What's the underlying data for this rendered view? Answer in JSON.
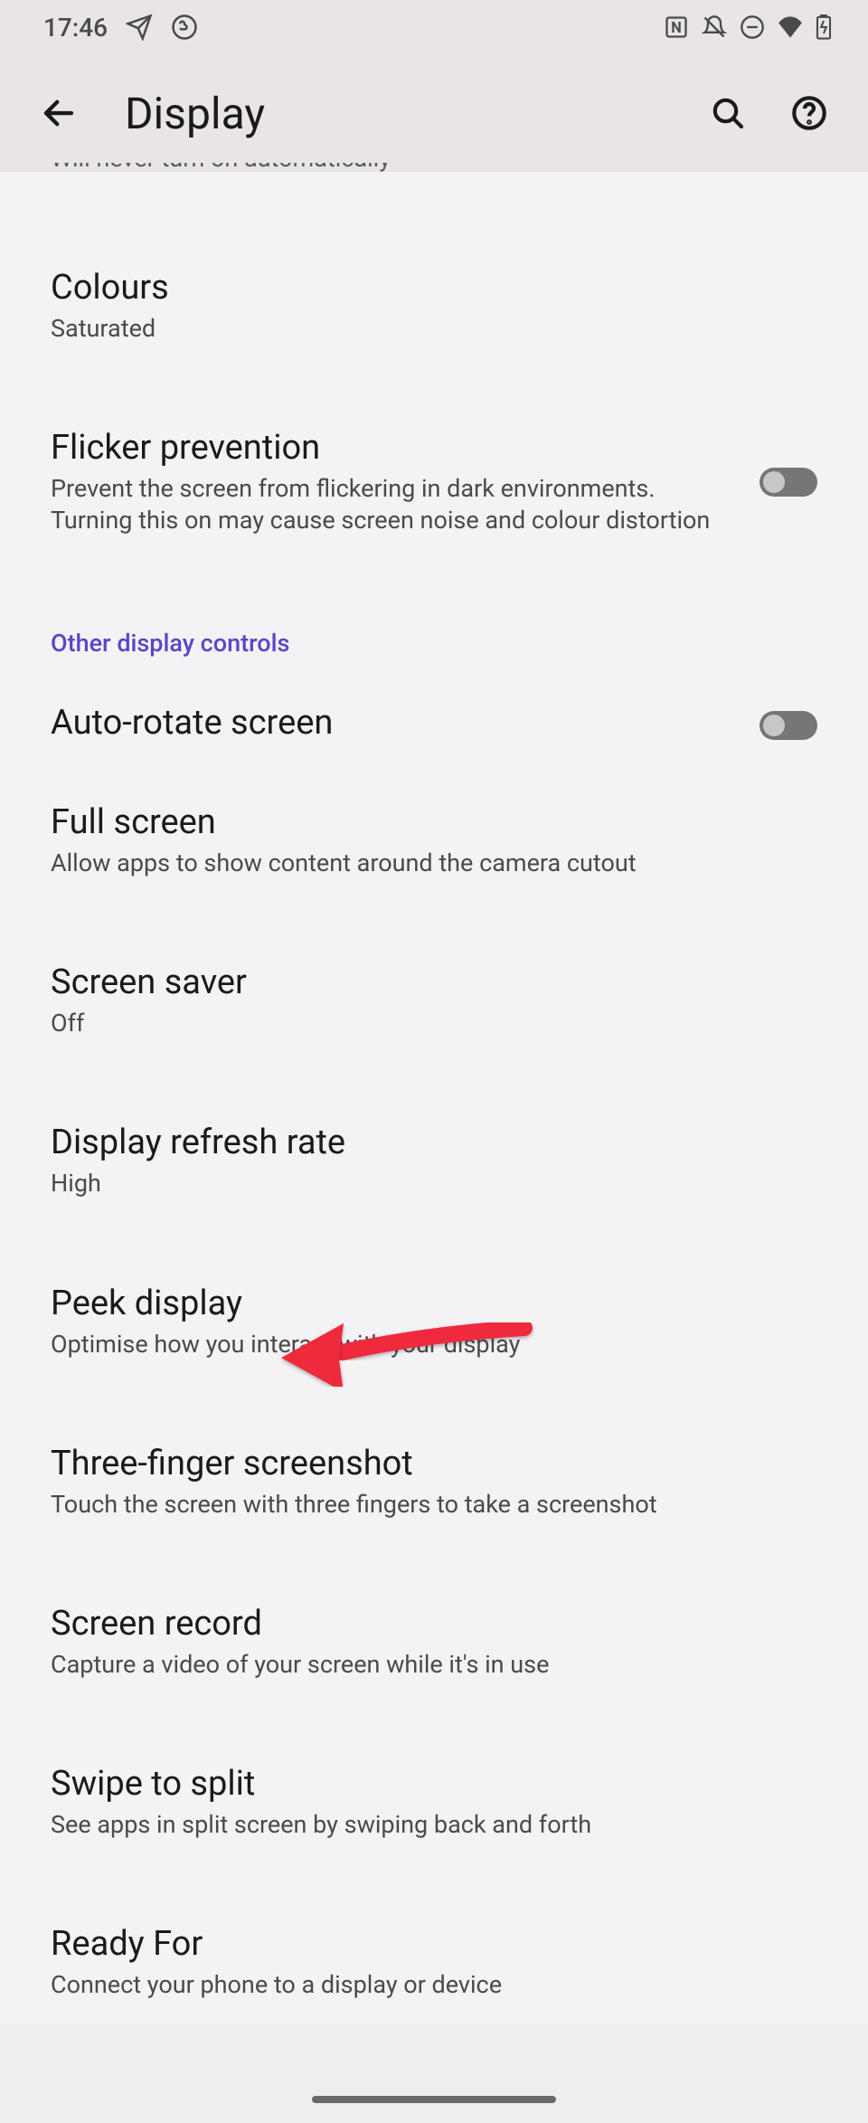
{
  "status": {
    "time": "17:46",
    "icons": {
      "telegram": "paper-plane-icon",
      "whatsapp": "whatsapp-icon",
      "nfc": "N",
      "mute": "bell-off-icon",
      "dnd": "dnd-icon",
      "wifi": "wifi-icon",
      "battery": "battery-charging-icon"
    }
  },
  "header": {
    "title": "Display"
  },
  "truncated": "Will never turn on automatically",
  "section_other": "Other display controls",
  "settings": {
    "colours": {
      "title": "Colours",
      "desc": "Saturated"
    },
    "flicker": {
      "title": "Flicker prevention",
      "desc": "Prevent the screen from flickering in dark environments. Turning this on may cause screen noise and colour distortion"
    },
    "autorotate": {
      "title": "Auto-rotate screen"
    },
    "fullscreen": {
      "title": "Full screen",
      "desc": "Allow apps to show content around the camera cutout"
    },
    "screensaver": {
      "title": "Screen saver",
      "desc": "Off"
    },
    "refresh": {
      "title": "Display refresh rate",
      "desc": "High"
    },
    "peek": {
      "title": "Peek display",
      "desc": "Optimise how you interact with your display"
    },
    "threefinger": {
      "title": "Three-finger screenshot",
      "desc": "Touch the screen with three fingers to take a screenshot"
    },
    "screenrecord": {
      "title": "Screen record",
      "desc": "Capture a video of your screen while it's in use"
    },
    "swipesplit": {
      "title": "Swipe to split",
      "desc": "See apps in split screen by swiping back and forth"
    },
    "readyfor": {
      "title": "Ready For",
      "desc": "Connect your phone to a display or device"
    }
  }
}
